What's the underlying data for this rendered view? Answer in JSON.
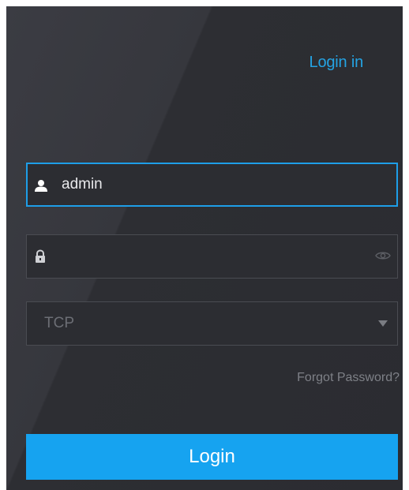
{
  "login": {
    "title": "Login in",
    "username": {
      "value": "admin",
      "icon": "user-icon"
    },
    "password": {
      "value": "",
      "icon": "lock-icon",
      "toggle_icon": "eye-icon"
    },
    "protocol": {
      "selected": "TCP",
      "icon": "chevron-down-icon"
    },
    "forgot_password": "Forgot Password?",
    "submit_label": "Login"
  },
  "colors": {
    "accent": "#16a3f0",
    "title": "#24a3e3",
    "panel": "#2f3036"
  }
}
